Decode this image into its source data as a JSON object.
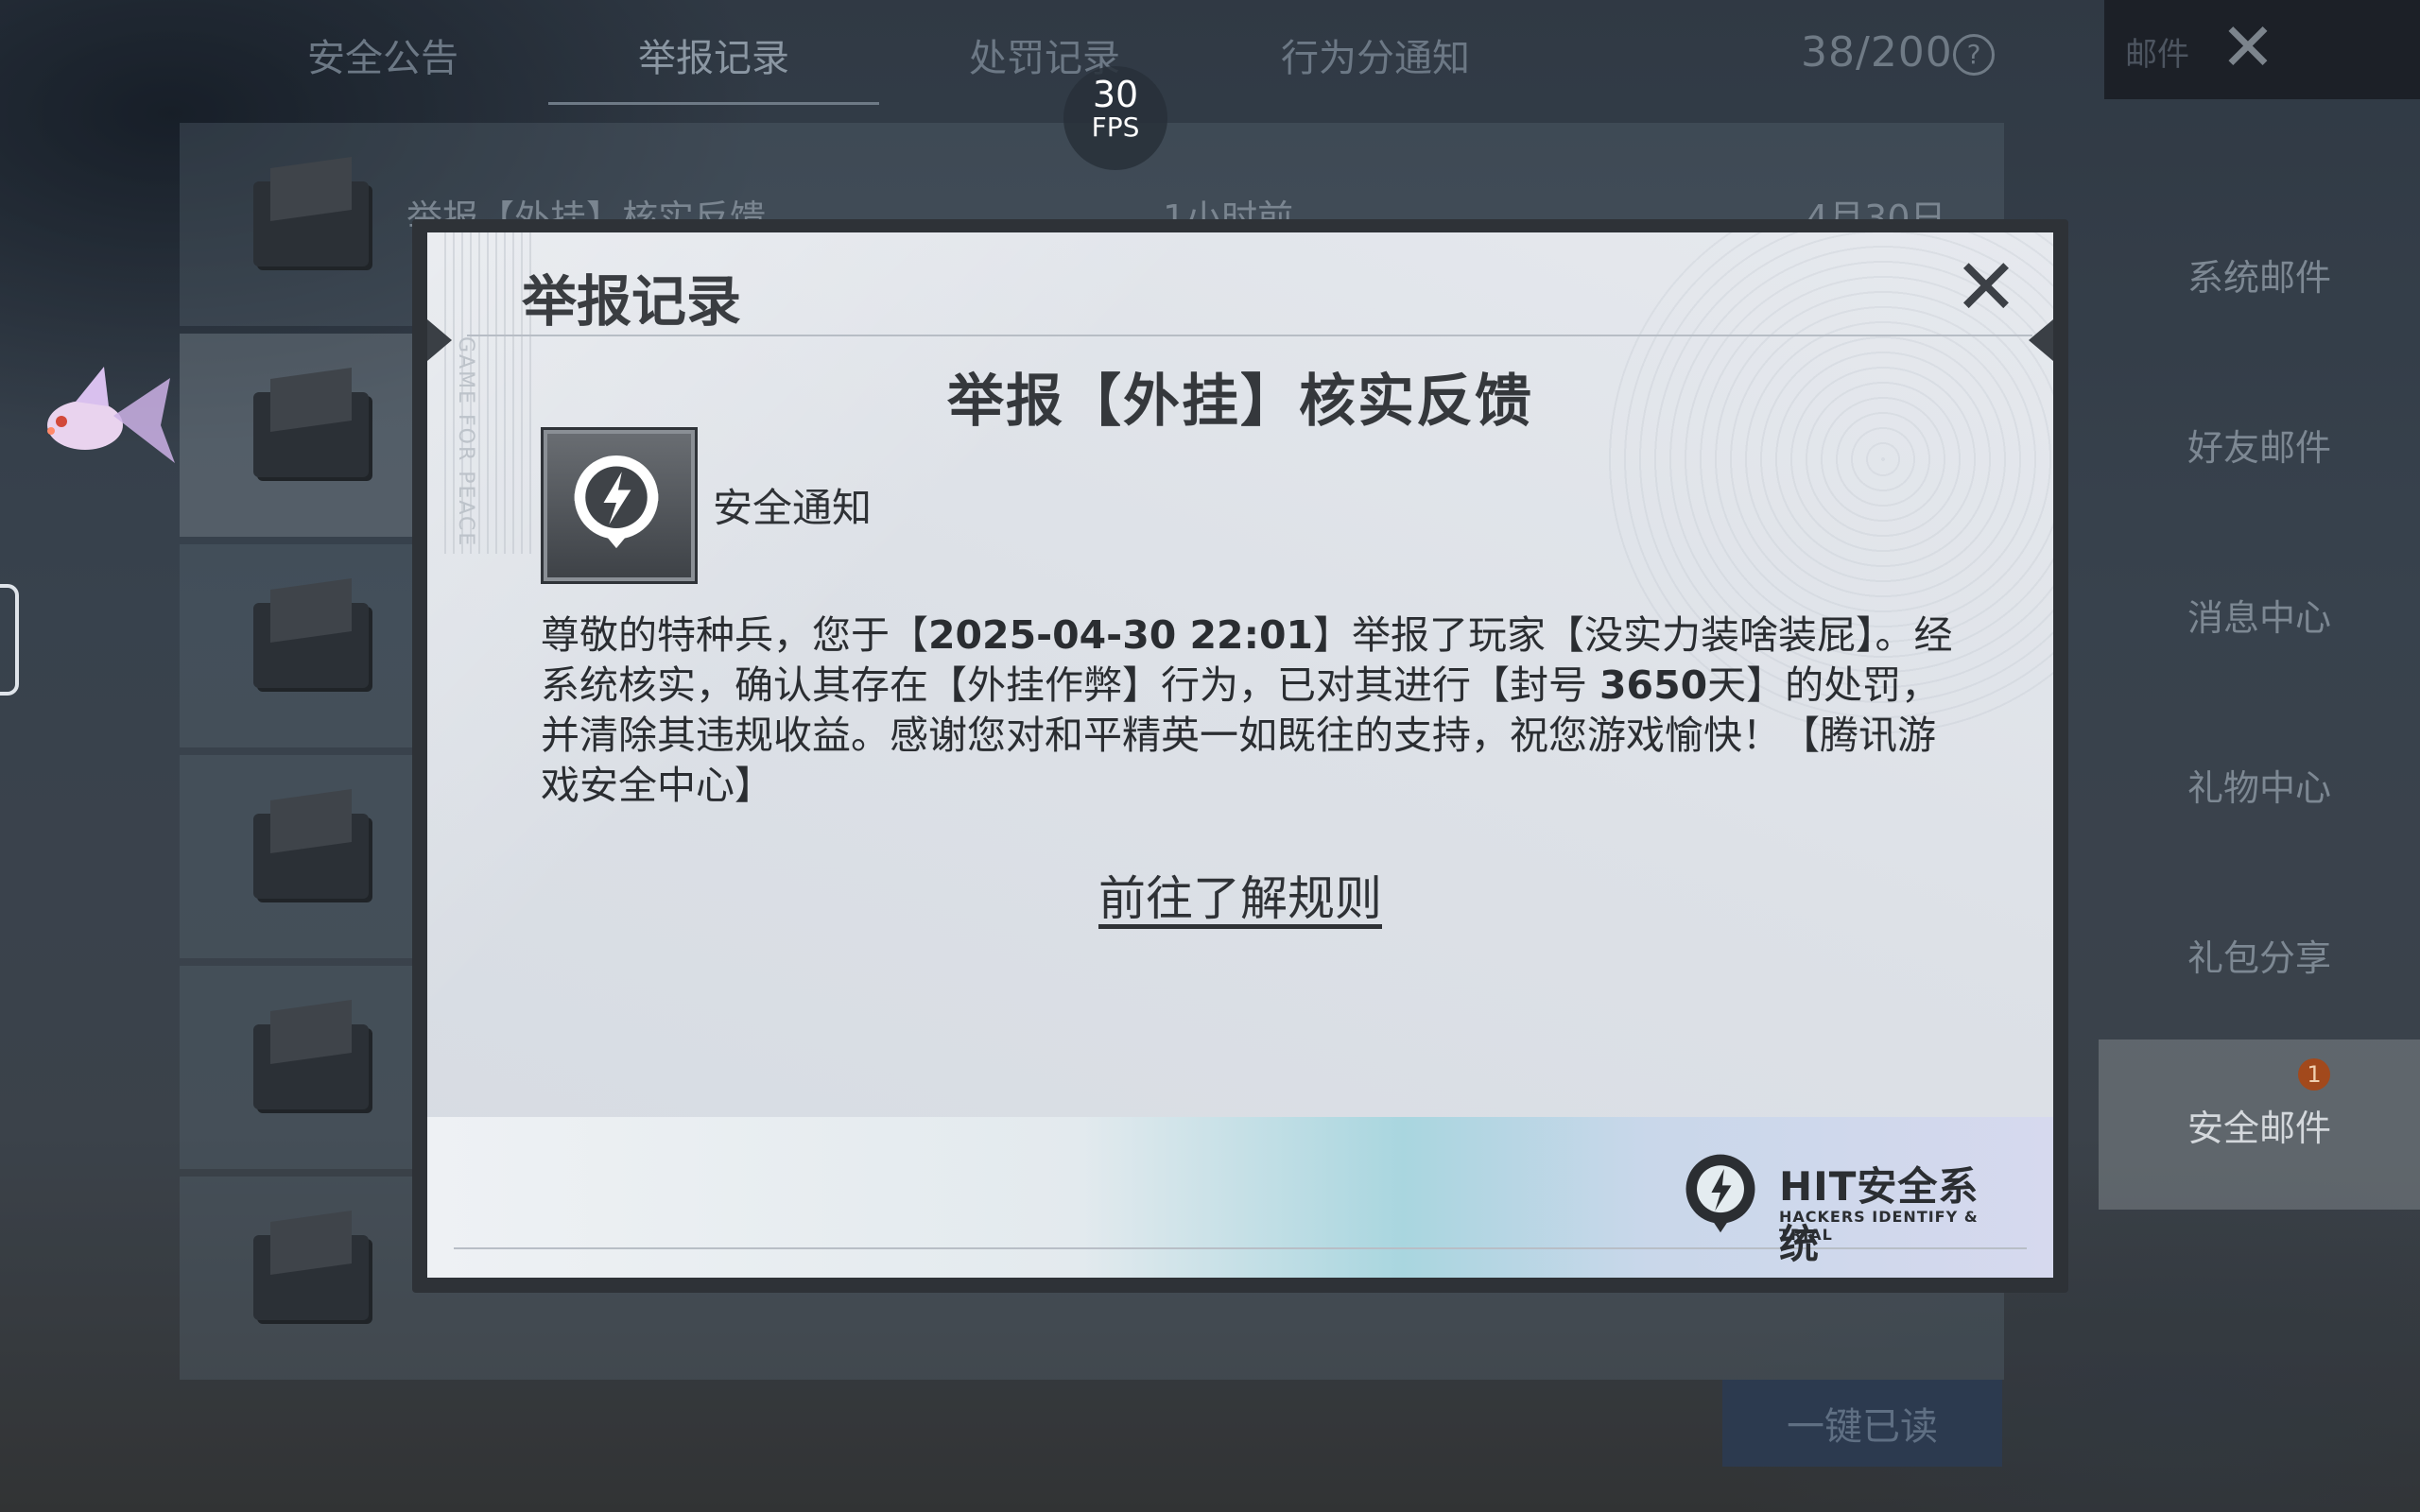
{
  "tabs": [
    "安全公告",
    "举报记录",
    "处罚记录",
    "行为分通知"
  ],
  "active_tab": "举报记录",
  "counter": "38/200",
  "mail_header": {
    "label": "邮件"
  },
  "fps": {
    "value": "30",
    "unit": "FPS"
  },
  "mail_list": {
    "first_row": {
      "title": "举报【外挂】核实反馈",
      "time": "1小时前",
      "date": "4月30日"
    }
  },
  "sidebar": {
    "items": [
      "系统邮件",
      "好友邮件",
      "消息中心",
      "礼物中心",
      "礼包分享",
      "安全邮件"
    ],
    "active": "安全邮件",
    "badge": "1"
  },
  "read_all_button": "一键已读",
  "modal": {
    "title": "举报记录",
    "side_text": "GAME FOR PEACE",
    "heading": "举报【外挂】核实反馈",
    "sender_label": "安全通知",
    "body": {
      "p1": "尊敬的特种兵，您于【",
      "datetime": "2025-04-30 22:01",
      "p2": "】举报了玩家【没实力装啥装屁】。经系统核实，确认其存在【外挂作弊】行为，已对其进行【封号 ",
      "ban_days": "3650",
      "p3": "天】的处罚，并清除其违规收益。感谢您对和平精英一如既往的支持，祝您游戏愉快！【腾讯游戏安全中心】"
    },
    "rules_link": "前往了解规则",
    "logo": {
      "title": "HIT安全系统",
      "subtitle": "HACKERS IDENTIFY & TRIAL"
    }
  },
  "colors": {
    "modal_bg": "#e2e6eb",
    "badge": "#a2491c",
    "button": "#2c3a4f"
  },
  "icons": [
    "close-icon",
    "help-icon",
    "envelope-icon",
    "security-notice-icon",
    "hit-logo-icon",
    "fish-pet-icon"
  ]
}
